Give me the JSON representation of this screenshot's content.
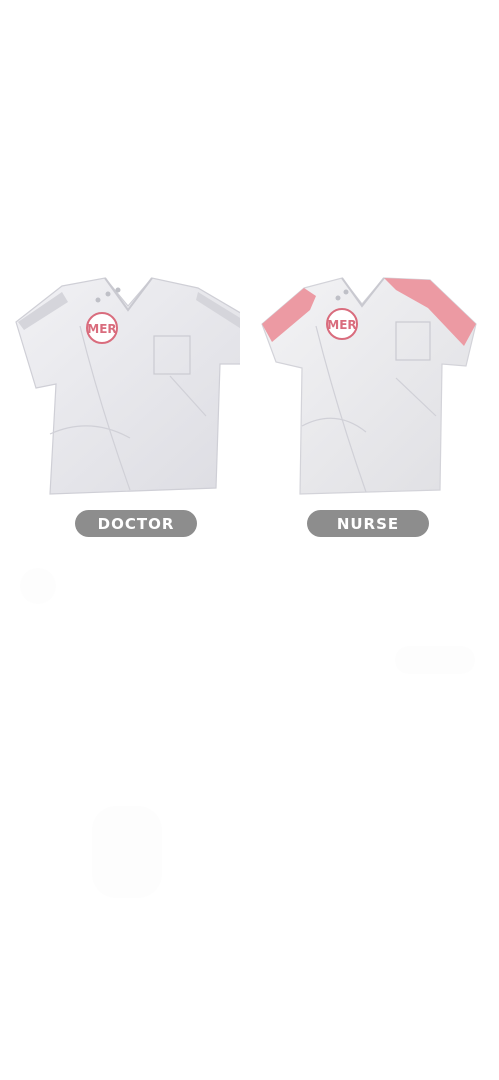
{
  "products": [
    {
      "id": "doctor",
      "label": "DOCTOR",
      "badge_text": "MER",
      "body_color": "#e9e9ee",
      "accent_color": "#d9d9de",
      "badge_color": "#d96c7d"
    },
    {
      "id": "nurse",
      "label": "NURSE",
      "badge_text": "MER",
      "body_color": "#ececee",
      "accent_color": "#ec9aa3",
      "badge_color": "#d96c7d"
    }
  ],
  "colors": {
    "pill_background": "#8d8d8d",
    "pill_text": "#ffffff",
    "page_background": "#ffffff"
  }
}
